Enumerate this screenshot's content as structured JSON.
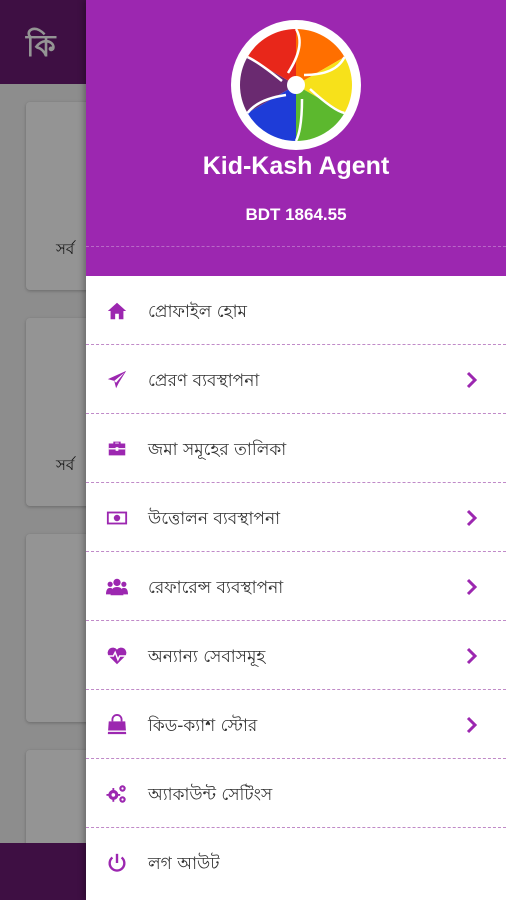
{
  "background": {
    "logo_text": "কি",
    "card_texts": [
      "সর্ব",
      "সর্ব"
    ]
  },
  "drawer": {
    "app_name": "Kid-Kash Agent",
    "balance": "BDT 1864.55",
    "menu": [
      {
        "label": "প্রোফাইল হোম",
        "icon": "home-icon",
        "has_chevron": false
      },
      {
        "label": "প্রেরণ ব্যবস্থাপনা",
        "icon": "send-icon",
        "has_chevron": true
      },
      {
        "label": "জমা সমূহের তালিকা",
        "icon": "briefcase-icon",
        "has_chevron": false
      },
      {
        "label": "উত্তোলন ব্যবস্থাপনা",
        "icon": "money-icon",
        "has_chevron": true
      },
      {
        "label": "রেফারেন্স ব্যবস্থাপনা",
        "icon": "users-icon",
        "has_chevron": true
      },
      {
        "label": "অন্যান্য সেবাসমূহ",
        "icon": "heartbeat-icon",
        "has_chevron": true
      },
      {
        "label": "কিড-ক্যাশ স্টোর",
        "icon": "shopping-bag-icon",
        "has_chevron": true
      },
      {
        "label": "অ্যাকাউন্ট সেটিংস",
        "icon": "cogs-icon",
        "has_chevron": false
      },
      {
        "label": "লগ আউট",
        "icon": "power-icon",
        "has_chevron": false
      }
    ]
  },
  "colors": {
    "header": "#9c27b0",
    "accent": "#9c27b0",
    "appbar": "#6c1a74"
  }
}
